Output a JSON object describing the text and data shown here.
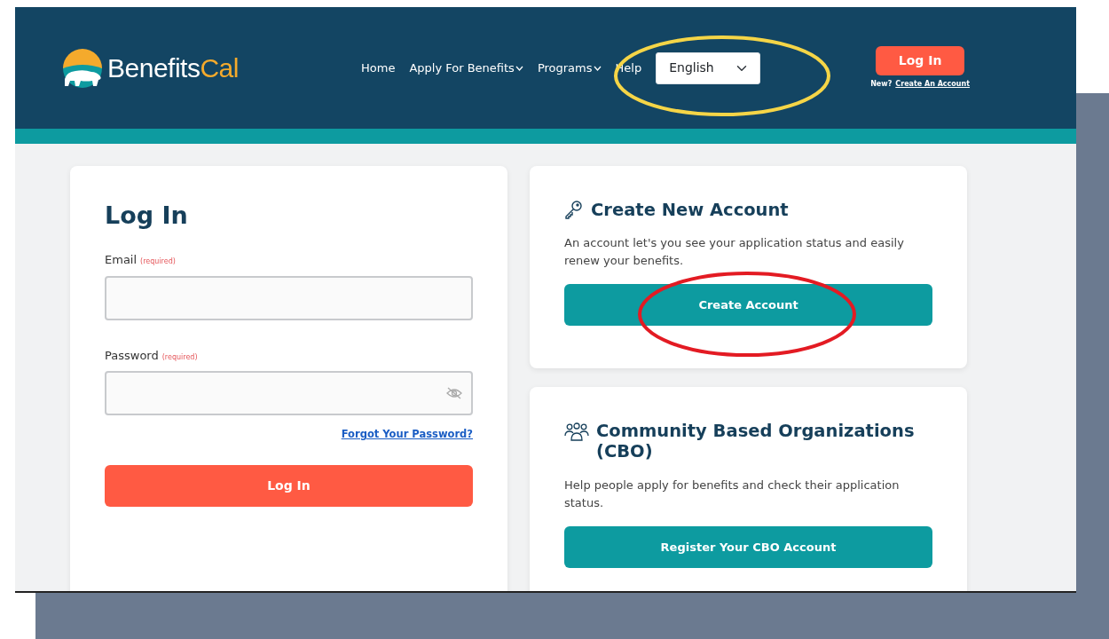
{
  "header": {
    "logo": {
      "first": "Benefits",
      "second": "Cal"
    },
    "nav": [
      {
        "label": "Home",
        "dropdown": false
      },
      {
        "label": "Apply For Benefits",
        "dropdown": true
      },
      {
        "label": "Programs",
        "dropdown": true
      },
      {
        "label": "Help",
        "dropdown": false
      }
    ],
    "language_select": {
      "value": "English"
    },
    "login_button": "Log In",
    "new_prompt": "New?",
    "create_link": "Create An Account"
  },
  "login_card": {
    "title": "Log In",
    "fields": [
      {
        "label": "Email",
        "note": "(required)",
        "kind": "text"
      },
      {
        "label": "Password",
        "note": "(required)",
        "kind": "password"
      }
    ],
    "forgot_link": "Forgot Your Password?",
    "button": "Log In"
  },
  "create_card": {
    "title": "Create New Account",
    "description": "An account let's you see your application status and easily renew your benefits.",
    "button": "Create Account"
  },
  "cbo_card": {
    "title": "Community Based Organizations (CBO)",
    "description": "Help people apply for benefits and check their application status.",
    "button": "Register Your CBO Account"
  },
  "annotations": [
    {
      "kind": "ellipse",
      "color": "#f5d547"
    },
    {
      "kind": "ellipse",
      "color": "#e31b23"
    }
  ]
}
